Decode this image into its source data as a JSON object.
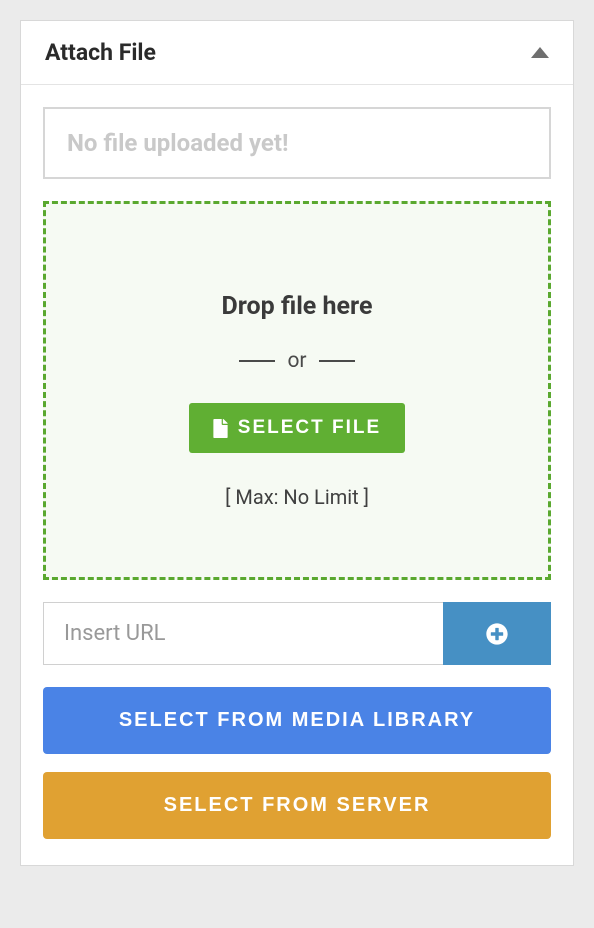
{
  "panel": {
    "title": "Attach File"
  },
  "status": {
    "message": "No file uploaded yet!"
  },
  "dropzone": {
    "heading": "Drop file here",
    "or_label": "or",
    "select_label": "SELECT FILE",
    "max_label": "[ Max: No Limit ]"
  },
  "url": {
    "placeholder": "Insert URL"
  },
  "buttons": {
    "media_library": "SELECT FROM MEDIA LIBRARY",
    "server": "SELECT FROM SERVER"
  }
}
